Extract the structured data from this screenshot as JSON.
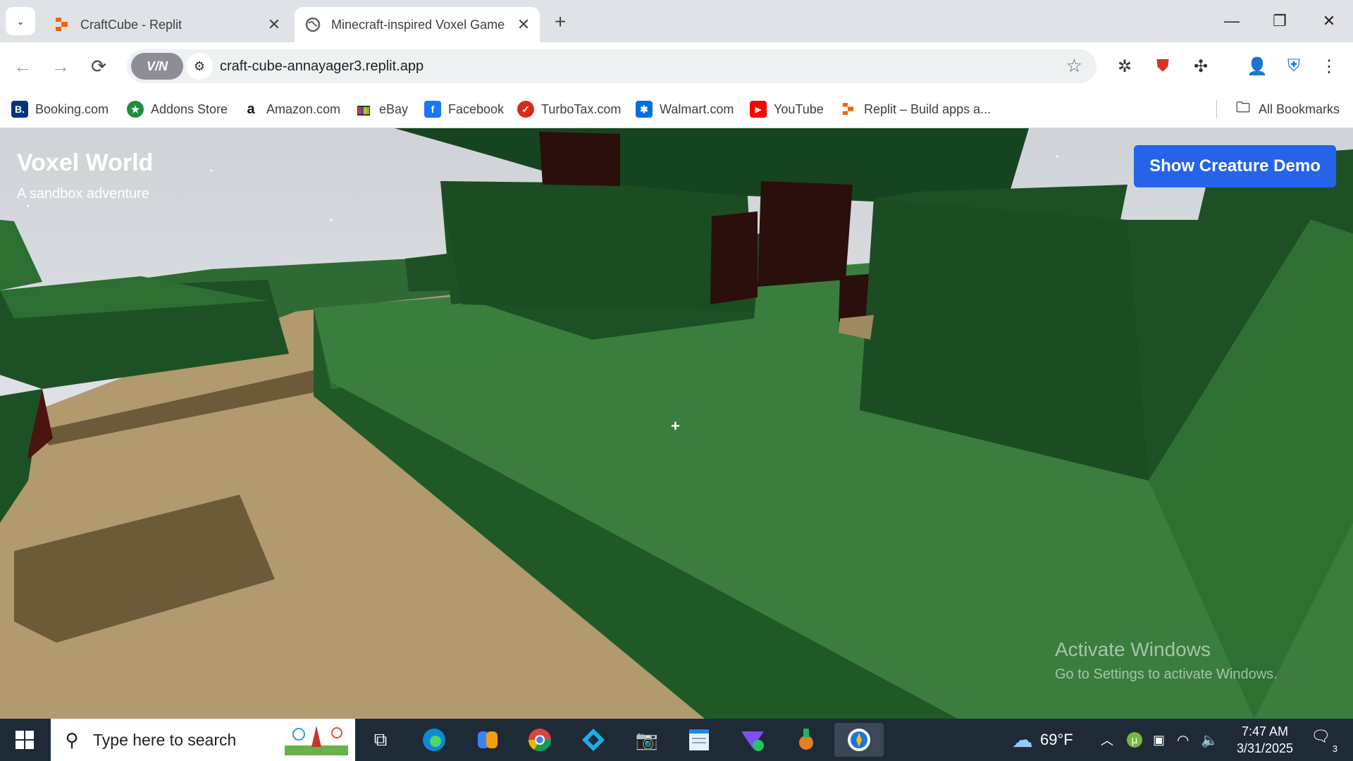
{
  "browser": {
    "tabs": [
      {
        "title": "CraftCube - Replit",
        "favicon": "replit-icon"
      },
      {
        "title": "Minecraft-inspired Voxel Game",
        "favicon": "globe-icon",
        "active": true
      }
    ],
    "url": "craft-cube-annayager3.replit.app",
    "vpn_label": "V/N",
    "bookmarks": [
      {
        "label": "Booking.com",
        "icon": "booking-icon",
        "color": "#003580",
        "glyph": "B."
      },
      {
        "label": "Addons Store",
        "icon": "addons-store-icon",
        "color": "#1e8e3e",
        "glyph": "★"
      },
      {
        "label": "Amazon.com",
        "icon": "amazon-icon",
        "color": "#ffffff",
        "glyph": "a"
      },
      {
        "label": "eBay",
        "icon": "ebay-icon",
        "color": "#ffffff",
        "glyph": "🛍"
      },
      {
        "label": "Facebook",
        "icon": "facebook-icon",
        "color": "#1877f2",
        "glyph": "f"
      },
      {
        "label": "TurboTax.com",
        "icon": "turbotax-icon",
        "color": "#d52b1e",
        "glyph": "✓"
      },
      {
        "label": "Walmart.com",
        "icon": "walmart-icon",
        "color": "#0071dc",
        "glyph": "✱"
      },
      {
        "label": "YouTube",
        "icon": "youtube-icon",
        "color": "#ff0000",
        "glyph": "▶"
      },
      {
        "label": "Replit – Build apps a...",
        "icon": "replit-icon",
        "color": "#f26207",
        "glyph": "⬢"
      }
    ],
    "all_bookmarks": "All Bookmarks"
  },
  "game": {
    "title": "Voxel World",
    "subtitle": "A sandbox adventure",
    "demo_button": "Show Creature Demo",
    "crosshair": "+"
  },
  "watermark": {
    "line1": "Activate Windows",
    "line2": "Go to Settings to activate Windows."
  },
  "taskbar": {
    "search_placeholder": "Type here to search",
    "weather": "69°F",
    "time": "7:47 AM",
    "date": "3/31/2025",
    "notifications": "3"
  },
  "colors": {
    "accent_button": "#2563eb",
    "leaf_dark": "#1d5125",
    "grass": "#3a7d3e",
    "sand": "#b09a6e",
    "wood": "#2b0f0c"
  }
}
